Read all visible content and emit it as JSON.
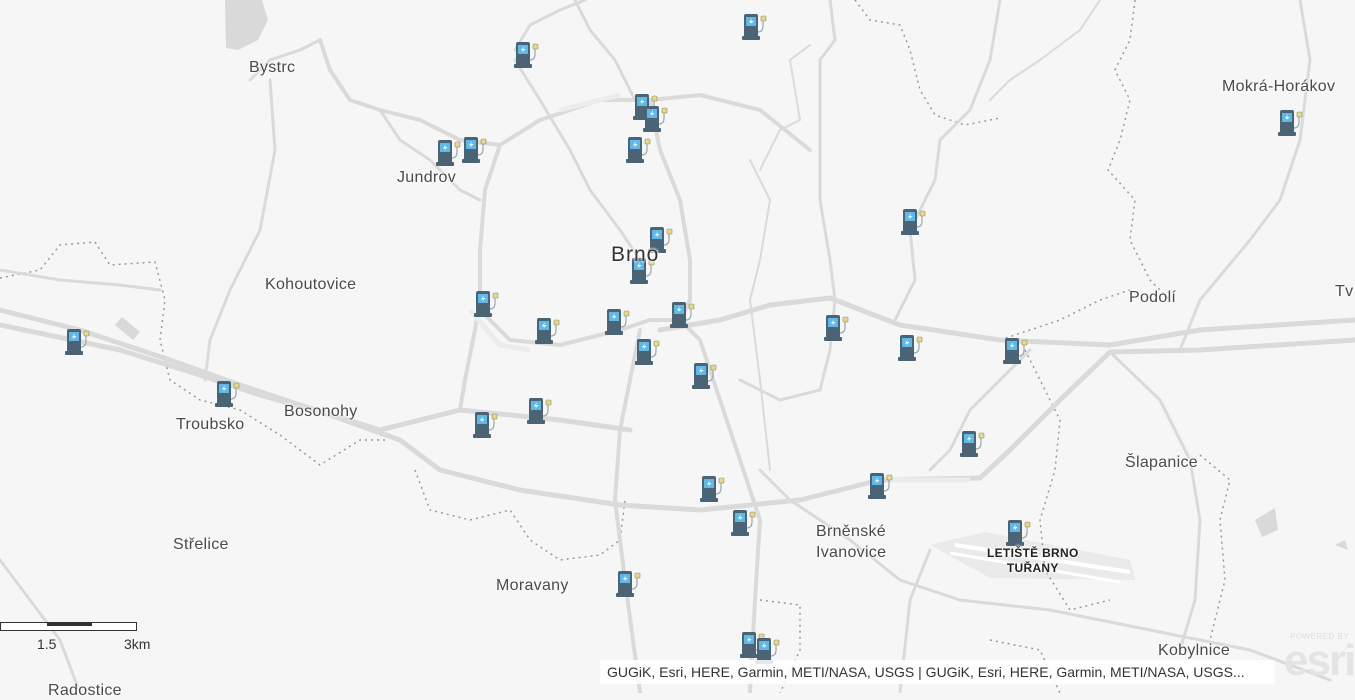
{
  "map": {
    "place_labels": [
      {
        "text": "Bystrc",
        "kind": "town"
      },
      {
        "text": "Jundrov",
        "kind": "town"
      },
      {
        "text": "Kohoutovice",
        "kind": "town"
      },
      {
        "text": "Brno",
        "kind": "city"
      },
      {
        "text": "Mokrá-Horákov",
        "kind": "town"
      },
      {
        "text": "Podolí",
        "kind": "town"
      },
      {
        "text": "Tv",
        "kind": "town"
      },
      {
        "text": "Bosonohy",
        "kind": "town"
      },
      {
        "text": "Troubsko",
        "kind": "town"
      },
      {
        "text": "Šlapanice",
        "kind": "town"
      },
      {
        "text": "Střelice",
        "kind": "town"
      },
      {
        "text": "Brněnské",
        "kind": "town"
      },
      {
        "text": "Ivanovice",
        "kind": "town"
      },
      {
        "text": "Moravany",
        "kind": "town"
      },
      {
        "text": "Kobylnice",
        "kind": "town"
      },
      {
        "text": "Radostice",
        "kind": "town"
      }
    ],
    "airport_label": [
      "LETIŠTĚ BRNO",
      "TUŘANY"
    ],
    "charger_icon": "ev-charging-station-icon",
    "colors": {
      "background": "#f6f6f6",
      "road": "#dadada",
      "charger_body": "#4a6475",
      "charger_screen": "#5fb8e6"
    }
  },
  "scale_bar": {
    "labels": [
      "1.5",
      "3km"
    ]
  },
  "attribution": {
    "text": "GUGiK, Esri, HERE, Garmin, METI/NASA, USGS | GUGiK, Esri, HERE, Garmin, METI/NASA, USGS..."
  },
  "esri_logo": {
    "powered_text": "POWERED BY",
    "word": "esri"
  }
}
